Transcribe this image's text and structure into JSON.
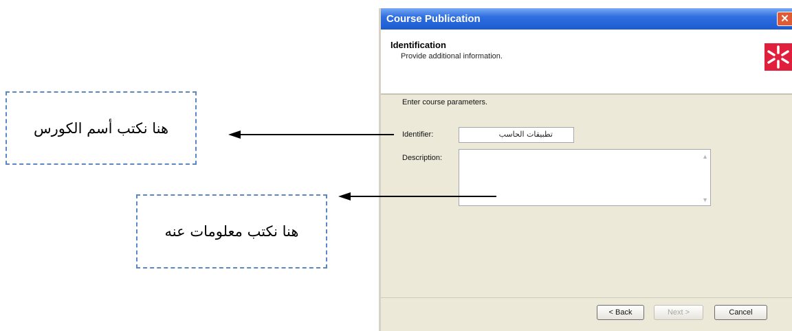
{
  "annotations": {
    "course_name_note": "هنا نكتب أسم الكورس",
    "description_note": "هنا نكتب معلومات عنه"
  },
  "dialog": {
    "title": "Course Publication",
    "header_title": "Identification",
    "header_subtitle": "Provide additional information.",
    "intro": "Enter course parameters.",
    "identifier_label": "Identifier:",
    "identifier_value": "تطبيقات الحاسب",
    "description_label": "Description:",
    "description_value": "",
    "back_label": "< Back",
    "next_label": "Next >",
    "cancel_label": "Cancel",
    "close_symbol": "✕"
  },
  "colors": {
    "titlebar": "#2f6fe0",
    "logo_bg": "#e01f3d",
    "callout_border": "#5b86c5"
  }
}
